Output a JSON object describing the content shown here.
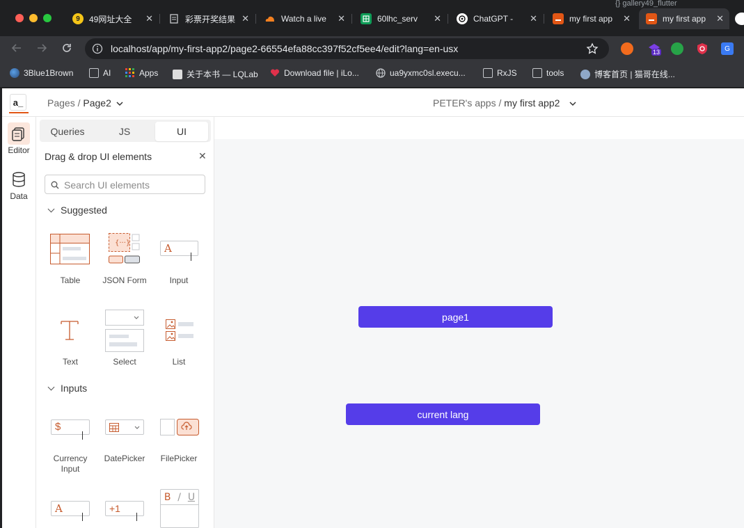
{
  "browser": {
    "tabs": [
      {
        "title": "49网址大全",
        "favicon": "49-icon"
      },
      {
        "title": "彩票开奖结果",
        "favicon": "document-icon"
      },
      {
        "title": "Watch a live",
        "favicon": "cloud-icon"
      },
      {
        "title": "60lhc_serv",
        "favicon": "sheets-icon"
      },
      {
        "title": "ChatGPT - ",
        "favicon": "chatgpt-icon"
      },
      {
        "title": "my first app",
        "favicon": "appsmith-icon"
      },
      {
        "title": "my first app",
        "favicon": "appsmith-icon"
      }
    ],
    "close_glyph": "✕",
    "background_tab_text": "{} gallery49_flutter",
    "url": "localhost/app/my-first-app2/page2-66554efa88cc397f52cf5ee4/edit?lang=en-usx",
    "extension_badge": "13",
    "bookmarks": [
      {
        "label": "3Blue1Brown",
        "icon": "3b1b-icon"
      },
      {
        "label": "AI",
        "icon": "folder-icon"
      },
      {
        "label": "Apps",
        "icon": "apps-grid-icon"
      },
      {
        "label": "关于本书 — LQLab",
        "icon": "site-icon"
      },
      {
        "label": "Download file | iLo...",
        "icon": "heart-icon"
      },
      {
        "label": "ua9yxmc0sl.execu...",
        "icon": "globe-icon"
      },
      {
        "label": "RxJS",
        "icon": "folder-icon"
      },
      {
        "label": "tools",
        "icon": "folder-icon"
      },
      {
        "label": "博客首页 | 猫哥在线...",
        "icon": "avatar-icon"
      }
    ]
  },
  "app": {
    "logo": "a_",
    "breadcrumb_root": "Pages /",
    "page_name": "Page2",
    "workspace": "PETER's apps /",
    "app_name": "my first app2",
    "rail": [
      {
        "label": "Editor",
        "icon": "editor-icon"
      },
      {
        "label": "Data",
        "icon": "database-icon"
      }
    ],
    "tabs": [
      "Queries",
      "JS",
      "UI"
    ],
    "active_tab": "UI",
    "panel_title": "Drag & drop UI elements",
    "close_glyph": "✕",
    "search_placeholder": "Search UI elements",
    "sections": {
      "suggested": "Suggested",
      "inputs": "Inputs"
    },
    "suggested_widgets": [
      {
        "label": "Table",
        "icon": "table-widget-icon"
      },
      {
        "label": "JSON Form",
        "icon": "json-form-widget-icon"
      },
      {
        "label": "Input",
        "icon": "input-widget-icon"
      },
      {
        "label": "Text",
        "icon": "text-widget-icon"
      },
      {
        "label": "Select",
        "icon": "select-widget-icon"
      },
      {
        "label": "List",
        "icon": "list-widget-icon"
      }
    ],
    "input_widgets": [
      {
        "label": "Currency Input",
        "icon": "currency-input-icon"
      },
      {
        "label": "DatePicker",
        "icon": "datepicker-icon"
      },
      {
        "label": "FilePicker",
        "icon": "filepicker-icon"
      }
    ],
    "widget_icon_glyphs": {
      "input": "A",
      "currency": "$",
      "counter": "+1",
      "rich_text": [
        "B",
        "/",
        "U"
      ]
    },
    "canvas_buttons": [
      "page1",
      "current lang"
    ],
    "accent_color": "#553de9",
    "brand_orange": "#e15615"
  }
}
